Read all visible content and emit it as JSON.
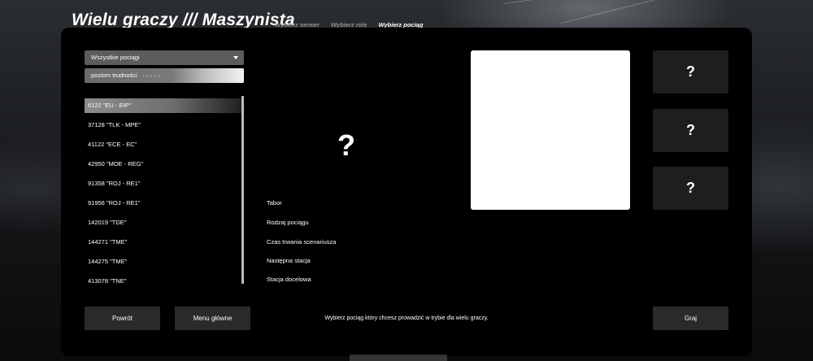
{
  "header": {
    "title": "Wielu graczy /// Maszynista",
    "breadcrumbs": [
      {
        "label": "Wybierz serwer",
        "active": false
      },
      {
        "label": "Wybierz rolę",
        "active": false
      },
      {
        "label": "Wybierz pociąg",
        "active": true
      }
    ]
  },
  "filters": {
    "train_filter": "Wszystkie pociągi",
    "difficulty_label": "poziom trudności",
    "difficulty_stars": 5
  },
  "train_list": {
    "items": [
      {
        "label": "6122 \"EU - EIP\"",
        "selected": true
      },
      {
        "label": "37128 \"TLK - MPE\"",
        "selected": false
      },
      {
        "label": "41122 \"ECE - EC\"",
        "selected": false
      },
      {
        "label": "42950 \"MOE - REG\"",
        "selected": false
      },
      {
        "label": "91358 \"ROJ - RE1\"",
        "selected": false
      },
      {
        "label": "91956 \"ROJ - RE1\"",
        "selected": false
      },
      {
        "label": "142019 \"TDE\"",
        "selected": false
      },
      {
        "label": "144271 \"TME\"",
        "selected": false
      },
      {
        "label": "144275 \"TME\"",
        "selected": false
      },
      {
        "label": "413078 \"TNE\"",
        "selected": false
      }
    ]
  },
  "details": {
    "placeholder": "?",
    "labels": [
      "Tabor",
      "Rodzaj pociągu",
      "Czas trwania scenariusza",
      "Następna stacja",
      "Stacja docelowa"
    ]
  },
  "slots": [
    "?",
    "?",
    "?"
  ],
  "footer": {
    "back_label": "Powrót",
    "main_menu_label": "Menu główne",
    "hint": "Wybierz pociąg który chcesz prowadzić w trybie dla wielu graczy.",
    "play_label": "Graj"
  },
  "colors": {
    "panel": "#000000",
    "button": "#2a2a2a",
    "breadcrumb_inactive": "#8f8f8f",
    "breadcrumb_active": "#ffffff"
  }
}
